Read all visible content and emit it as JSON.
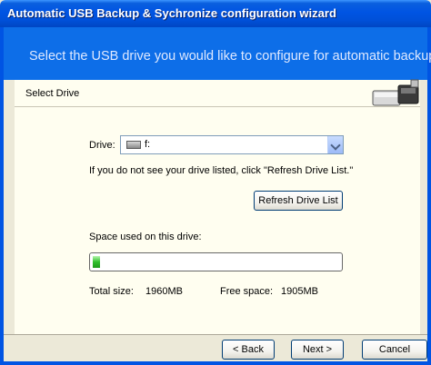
{
  "window": {
    "title": "Automatic USB Backup & Sychronize configuration wizard"
  },
  "header": {
    "subtitle": "Select the USB drive you would like to configure for automatic backup"
  },
  "section": {
    "title": "Select Drive"
  },
  "drive": {
    "label": "Drive:",
    "value": "f:"
  },
  "hint": "If you do not see your drive listed, click \"Refresh Drive List.\"",
  "refresh_button": "Refresh Drive List",
  "space": {
    "label": "Space used on this drive:",
    "used_fraction": 0.03
  },
  "stats": {
    "total_label": "Total size:",
    "total_value": "1960MB",
    "free_label": "Free space:",
    "free_value": "1905MB"
  },
  "buttons": {
    "back": "< Back",
    "next": "Next >",
    "cancel": "Cancel"
  },
  "colors": {
    "title_bar": "#0054e3",
    "header_band": "#0d6ee8",
    "content_bg": "#fffef0",
    "progress_fill": "#2fbf2a"
  },
  "icons": {
    "drive_icon": "usb-drive-icon",
    "dropdown_arrow": "chevron-down-icon",
    "section_graphic": "usb-drive-graphic"
  }
}
